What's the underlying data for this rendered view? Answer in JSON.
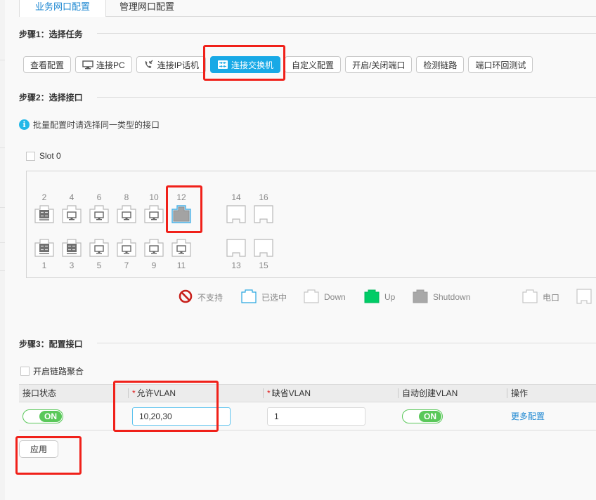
{
  "tabs": [
    {
      "label": "业务网口配置",
      "active": true
    },
    {
      "label": "管理网口配置",
      "active": false
    }
  ],
  "step1": {
    "title": "步骤1：选择任务",
    "buttons": [
      {
        "label": "查看配置",
        "icon": null,
        "active": false
      },
      {
        "label": "连接PC",
        "icon": "monitor-icon",
        "active": false
      },
      {
        "label": "连接IP话机",
        "icon": "phone-icon",
        "active": false
      },
      {
        "label": "连接交换机",
        "icon": "switch-icon",
        "active": true
      },
      {
        "label": "自定义配置",
        "icon": null,
        "active": false
      },
      {
        "label": "开启/关闭端口",
        "icon": null,
        "active": false
      },
      {
        "label": "检测链路",
        "icon": null,
        "active": false
      },
      {
        "label": "端口环回测试",
        "icon": null,
        "active": false
      }
    ]
  },
  "step2": {
    "title": "步骤2：选择接口",
    "info": "批量配置时请选择同一类型的接口",
    "slot_label": "Slot 0",
    "ports_top": [
      {
        "num": "2",
        "type": "switch",
        "state": "down"
      },
      {
        "num": "4",
        "type": "pc",
        "state": "down"
      },
      {
        "num": "6",
        "type": "pc",
        "state": "down"
      },
      {
        "num": "8",
        "type": "pc",
        "state": "down"
      },
      {
        "num": "10",
        "type": "pc",
        "state": "down"
      },
      {
        "num": "12",
        "type": "electric",
        "state": "selected-shutdown"
      },
      {
        "num": "14",
        "type": "optical",
        "state": "down"
      },
      {
        "num": "16",
        "type": "optical",
        "state": "down"
      }
    ],
    "ports_bottom": [
      {
        "num": "1",
        "type": "switch",
        "state": "down"
      },
      {
        "num": "3",
        "type": "switch",
        "state": "down"
      },
      {
        "num": "5",
        "type": "pc",
        "state": "down"
      },
      {
        "num": "7",
        "type": "pc",
        "state": "down"
      },
      {
        "num": "9",
        "type": "pc",
        "state": "down"
      },
      {
        "num": "11",
        "type": "pc",
        "state": "down"
      },
      {
        "num": "13",
        "type": "optical",
        "state": "down"
      },
      {
        "num": "15",
        "type": "optical",
        "state": "down"
      }
    ],
    "legend": [
      {
        "label": "不支持",
        "icon": "not-supported-icon"
      },
      {
        "label": "已选中",
        "icon": "selected-port-icon"
      },
      {
        "label": "Down",
        "icon": "down-port-icon"
      },
      {
        "label": "Up",
        "icon": "up-port-icon"
      },
      {
        "label": "Shutdown",
        "icon": "shutdown-port-icon"
      },
      {
        "label": "电口",
        "icon": "electric-port-icon"
      },
      {
        "label": "",
        "icon": "optical-port-icon"
      }
    ]
  },
  "step3": {
    "title": "步骤3：配置接口",
    "aggregation_label": "开启链路聚合",
    "columns": [
      "接口状态",
      "允许VLAN",
      "缺省VLAN",
      "自动创建VLAN",
      "操作"
    ],
    "required_columns": [
      "允许VLAN",
      "缺省VLAN"
    ],
    "row": {
      "port_status": "ON",
      "allowed_vlan": "10,20,30",
      "default_vlan": "1",
      "auto_create_vlan": "ON",
      "action": "更多配置"
    },
    "apply_label": "应用"
  },
  "colors": {
    "accent": "#18a9e6",
    "link": "#1e88d2",
    "toggle_on": "#5ac85a",
    "up": "#00cc66",
    "shutdown": "#a8a8a8",
    "highlight": "#f0211a",
    "required": "#e02020"
  }
}
